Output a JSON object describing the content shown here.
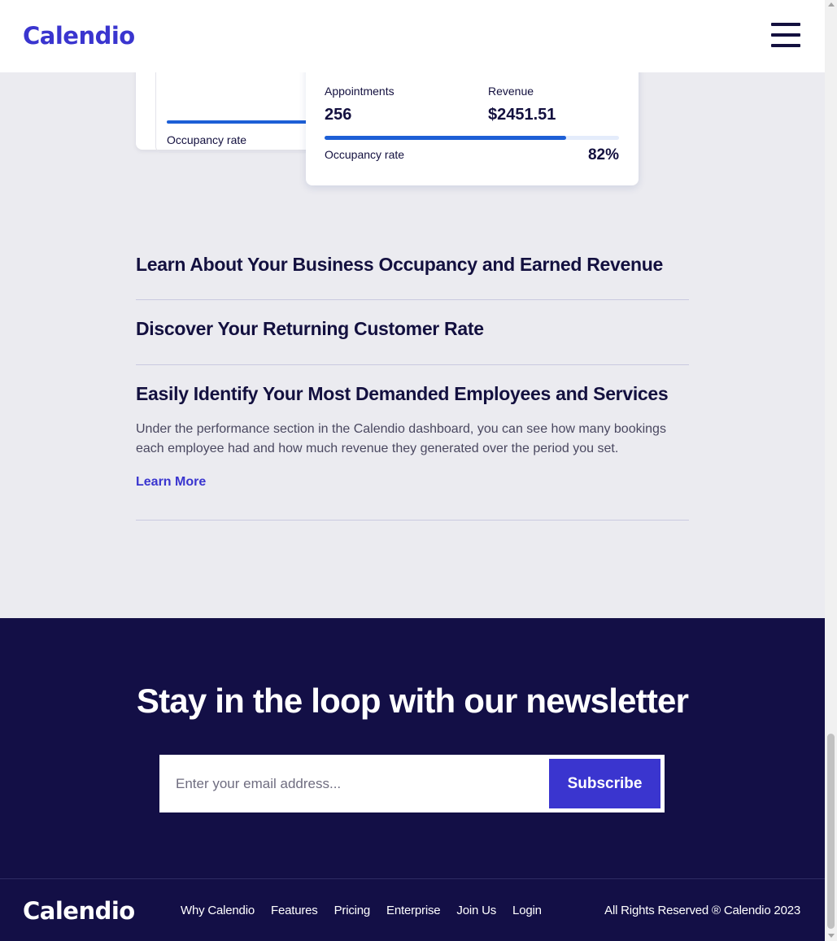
{
  "brand": {
    "logo_text": "Calendio",
    "accent_color": "#3a35cf",
    "dark_color": "#13103f"
  },
  "header": {
    "menu_icon": "hamburger-menu-icon"
  },
  "stats_back_card": {
    "occupancy_label": "Occupancy rate"
  },
  "stats_card": {
    "appointments_label": "Appointments",
    "appointments_value": "256",
    "revenue_label": "Revenue",
    "revenue_value": "$2451.51",
    "occupancy_label": "Occupancy rate",
    "occupancy_value": "82%",
    "occupancy_fraction": 0.82
  },
  "accordion": {
    "items": [
      {
        "title": "Learn About Your Business Occupancy and Earned Revenue"
      },
      {
        "title": "Discover Your Returning Customer Rate"
      },
      {
        "title": "Easily Identify Your Most Demanded Employees and Services",
        "body": "Under the performance section in the Calendio dashboard, you can see how many bookings each employee had and how much revenue they generated over the period you set.",
        "link": "Learn More"
      }
    ]
  },
  "newsletter": {
    "title": "Stay in the loop with our newsletter",
    "email_placeholder": "Enter your email address...",
    "email_value": "",
    "subscribe_label": "Subscribe"
  },
  "footer": {
    "logo_text": "Calendio",
    "nav": [
      "Why Calendio",
      "Features",
      "Pricing",
      "Enterprise",
      "Join Us",
      "Login"
    ],
    "copyright": "All Rights Reserved ® Calendio 2023"
  }
}
